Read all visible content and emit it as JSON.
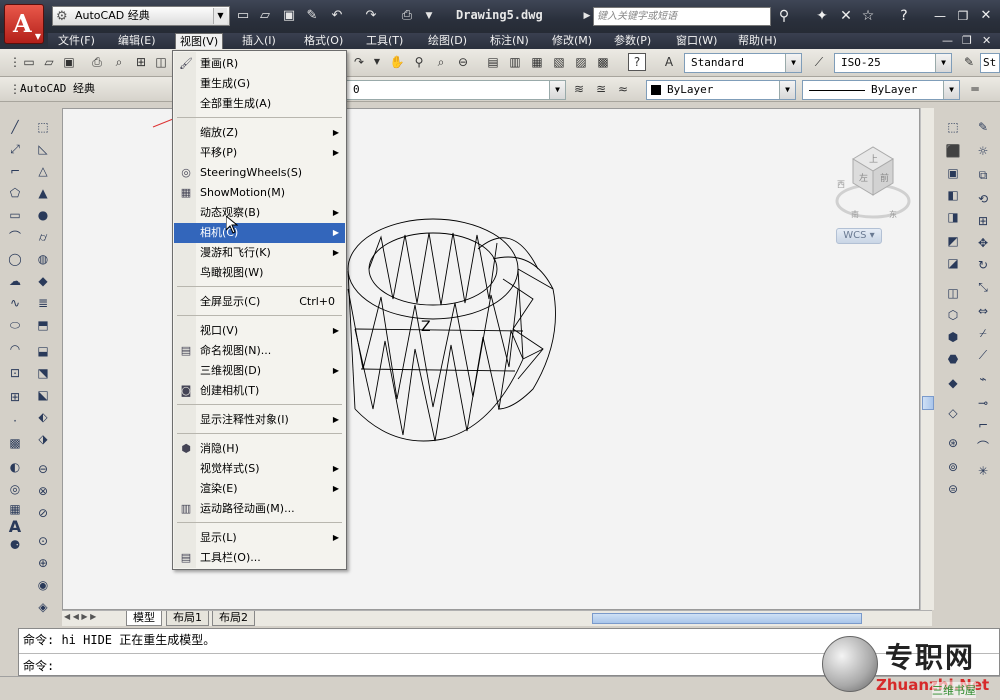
{
  "title_bar": {
    "workspace": "AutoCAD 经典",
    "document_title": "Drawing5.dwg",
    "search_placeholder": "键入关键字或短语",
    "logo_letter": "A"
  },
  "menu_bar": {
    "items": [
      {
        "label": "文件(F)"
      },
      {
        "label": "编辑(E)"
      },
      {
        "label": "视图(V)"
      },
      {
        "label": "插入(I)"
      },
      {
        "label": "格式(O)"
      },
      {
        "label": "工具(T)"
      },
      {
        "label": "绘图(D)"
      },
      {
        "label": "标注(N)"
      },
      {
        "label": "修改(M)"
      },
      {
        "label": "参数(P)"
      },
      {
        "label": "窗口(W)"
      },
      {
        "label": "帮助(H)"
      }
    ],
    "active_index": 2
  },
  "toolbar": {
    "text_style": "Standard",
    "dim_style": "ISO-25",
    "table_style": "St",
    "workspace_label": "AutoCAD 经典",
    "layer_value": "0",
    "color_value": "ByLayer",
    "linetype_value": "ByLayer"
  },
  "view_menu": {
    "items": [
      {
        "label": "重画(R)",
        "icon": "brush-icon"
      },
      {
        "label": "重生成(G)"
      },
      {
        "label": "全部重生成(A)"
      },
      {
        "label": "缩放(Z)",
        "submenu": true
      },
      {
        "label": "平移(P)",
        "submenu": true
      },
      {
        "label": "SteeringWheels(S)",
        "icon": "steering-wheel-icon"
      },
      {
        "label": "ShowMotion(M)",
        "icon": "showmotion-icon"
      },
      {
        "label": "动态观察(B)",
        "submenu": true
      },
      {
        "label": "相机(C)",
        "submenu": true,
        "highlighted": true
      },
      {
        "label": "漫游和飞行(K)",
        "submenu": true
      },
      {
        "label": "鸟瞰视图(W)"
      },
      {
        "label": "全屏显示(C)",
        "shortcut": "Ctrl+0"
      },
      {
        "label": "视口(V)",
        "submenu": true
      },
      {
        "label": "命名视图(N)...",
        "icon": "named-view-icon"
      },
      {
        "label": "三维视图(D)",
        "submenu": true
      },
      {
        "label": "创建相机(T)",
        "icon": "camera-icon"
      },
      {
        "label": "显示注释性对象(I)",
        "submenu": true
      },
      {
        "label": "消隐(H)",
        "icon": "hide-icon"
      },
      {
        "label": "视觉样式(S)",
        "submenu": true
      },
      {
        "label": "渲染(E)",
        "submenu": true
      },
      {
        "label": "运动路径动画(M)...",
        "icon": "motion-path-icon"
      },
      {
        "label": "显示(L)",
        "submenu": true
      },
      {
        "label": "工具栏(O)...",
        "icon": "toolbar-icon"
      }
    ]
  },
  "viewcube": {
    "top_label": "上",
    "front_label": "左",
    "right_label": "前",
    "compass_west": "西",
    "compass_south": "南",
    "compass_east": "东",
    "wcs_label": "WCS"
  },
  "canvas": {
    "axis_label": "Z"
  },
  "layout_tabs": [
    "模型",
    "布局1",
    "布局2"
  ],
  "command_line": {
    "history": "命令: hi HIDE 正在重生成模型。",
    "prompt": "命令:"
  },
  "watermark": {
    "title": "专职网",
    "url": "Zhuanzhi.Net",
    "subtitle": "三维书屋"
  }
}
